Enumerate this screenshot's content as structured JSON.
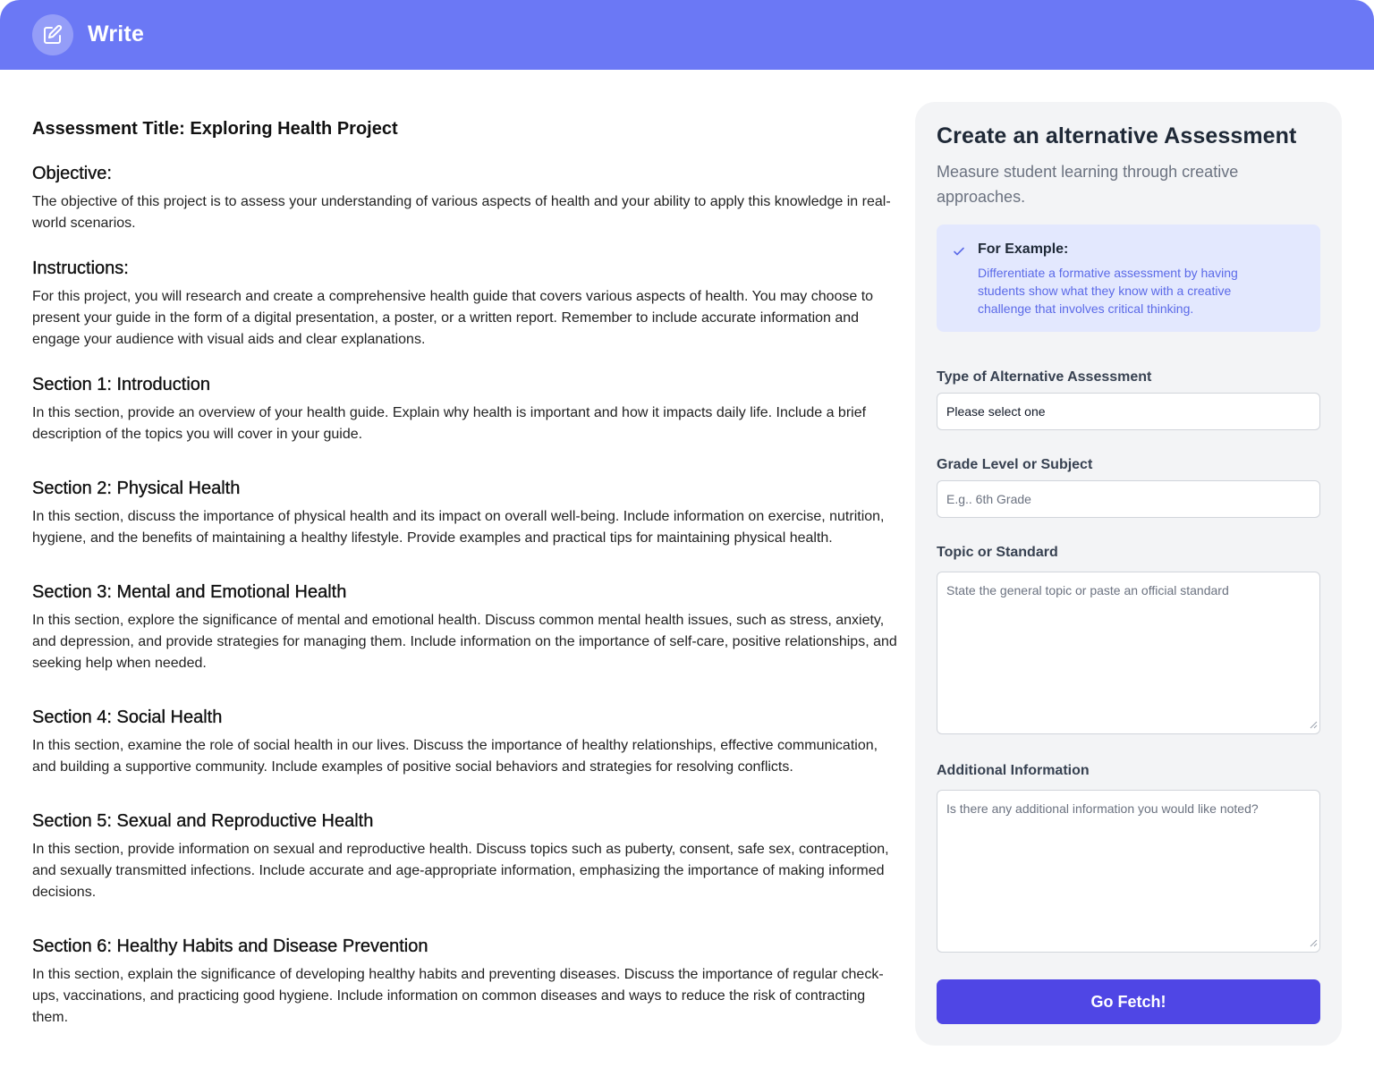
{
  "header": {
    "title": "Write",
    "icon": "edit-icon",
    "color": "#6b78f5"
  },
  "document": {
    "title": "Assessment Title: Exploring Health Project",
    "objective": {
      "heading": "Objective:",
      "text": "The objective of this project is to assess your understanding of various aspects of health and your ability to apply this knowledge in real-world scenarios."
    },
    "instructions": {
      "heading": "Instructions:",
      "text": "For this project, you will research and create a comprehensive health guide that covers various aspects of health. You may choose to present your guide in the form of a digital presentation, a poster, or a written report. Remember to include accurate information and engage your audience with visual aids and clear explanations."
    },
    "sections": [
      {
        "heading": "Section 1: Introduction",
        "text": "In this section, provide an overview of your health guide. Explain why health is important and how it impacts daily life. Include a brief description of the topics you will cover in your guide."
      },
      {
        "heading": "Section 2: Physical Health",
        "text": "In this section, discuss the importance of physical health and its impact on overall well-being. Include information on exercise, nutrition, hygiene, and the benefits of maintaining a healthy lifestyle. Provide examples and practical tips for maintaining physical health."
      },
      {
        "heading": "Section 3: Mental and Emotional Health",
        "text": "In this section, explore the significance of mental and emotional health. Discuss common mental health issues, such as stress, anxiety, and depression, and provide strategies for managing them. Include information on the importance of self-care, positive relationships, and seeking help when needed."
      },
      {
        "heading": "Section 4: Social Health",
        "text": "In this section, examine the role of social health in our lives. Discuss the importance of healthy relationships, effective communication, and building a supportive community. Include examples of positive social behaviors and strategies for resolving conflicts."
      },
      {
        "heading": "Section 5: Sexual and Reproductive Health",
        "text": "In this section, provide information on sexual and reproductive health. Discuss topics such as puberty, consent, safe sex, contraception, and sexually transmitted infections. Include accurate and age-appropriate information, emphasizing the importance of making informed decisions."
      },
      {
        "heading": "Section 6: Healthy Habits and Disease Prevention",
        "text": "In this section, explain the significance of developing healthy habits and preventing diseases. Discuss the importance of regular check-ups, vaccinations, and practicing good hygiene. Include information on common diseases and ways to reduce the risk of contracting them."
      }
    ]
  },
  "panel": {
    "title": "Create an alternative Assessment",
    "subtitle": "Measure student learning through creative approaches.",
    "example": {
      "icon": "check-icon",
      "label": "For Example:",
      "text": "Differentiate a formative assessment by having students show what they know with a creative challenge that involves critical thinking."
    },
    "fields": {
      "type": {
        "label": "Type of Alternative Assessment",
        "value": "Please select one"
      },
      "grade": {
        "label": "Grade Level or Subject",
        "placeholder": "E.g.. 6th Grade"
      },
      "topic": {
        "label": "Topic or Standard",
        "placeholder": "State the general topic or paste an official standard"
      },
      "additional": {
        "label": "Additional Information",
        "placeholder": "Is there any additional information you would like noted?"
      }
    },
    "submit_label": "Go Fetch!",
    "accent": "#4f46e5"
  }
}
